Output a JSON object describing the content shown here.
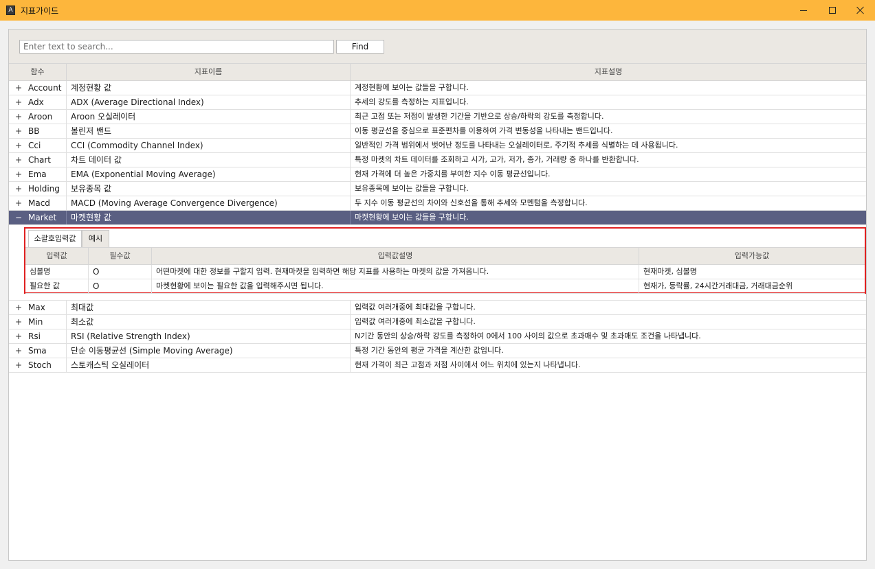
{
  "window": {
    "title": "지표가이드",
    "icon_letter": "A",
    "accent_color": "#fdb63c",
    "controls": [
      "minimize",
      "maximize",
      "close"
    ]
  },
  "search": {
    "placeholder": "Enter text to search...",
    "value": "",
    "find_label": "Find"
  },
  "grid": {
    "columns": [
      "함수",
      "지표이름",
      "지표설명"
    ],
    "selected_color": "#5a5f82",
    "rows_before": [
      {
        "expand": "+",
        "name": "Account",
        "display": "계정현황 값",
        "desc": "계정현황에 보이는 값들을 구합니다."
      },
      {
        "expand": "+",
        "name": "Adx",
        "display": "ADX (Average Directional Index)",
        "desc": "추세의 강도를 측정하는 지표입니다."
      },
      {
        "expand": "+",
        "name": "Aroon",
        "display": "Aroon 오실레이터",
        "desc": "최근 고점 또는 저점이 발생한 기간을 기반으로 상승/하락의 강도를 측정합니다."
      },
      {
        "expand": "+",
        "name": "BB",
        "display": "볼린저 밴드",
        "desc": "이동 평균선을 중심으로 표준편차를 이용하여 가격 변동성을 나타내는 밴드입니다."
      },
      {
        "expand": "+",
        "name": "Cci",
        "display": "CCI (Commodity Channel Index)",
        "desc": "일반적인 가격 범위에서 벗어난 정도를 나타내는 오실레이터로, 주기적 추세를 식별하는 데 사용됩니다."
      },
      {
        "expand": "+",
        "name": "Chart",
        "display": "차트 데이터 값",
        "desc": "특정 마켓의 차트 데이터를 조회하고 시가, 고가, 저가, 종가, 거래량 중 하나를 반환합니다."
      },
      {
        "expand": "+",
        "name": "Ema",
        "display": "EMA (Exponential Moving Average)",
        "desc": "현재 가격에 더 높은 가중치를 부여한 지수 이동 평균선입니다."
      },
      {
        "expand": "+",
        "name": "Holding",
        "display": "보유종목 값",
        "desc": "보유종목에 보이는 값들을 구합니다."
      },
      {
        "expand": "+",
        "name": "Macd",
        "display": "MACD (Moving Average Convergence Divergence)",
        "desc": "두 지수 이동 평균선의 차이와 신호선을 통해 추세와 모멘텀을 측정합니다."
      }
    ],
    "selected_row": {
      "expand": "−",
      "name": "Market",
      "display": "마켓현황 값",
      "desc": "마켓현황에 보이는 값들을 구합니다."
    },
    "detail": {
      "tabs": [
        "소괄호입력값",
        "예시"
      ],
      "columns": [
        "입력값",
        "필수값",
        "입력값설명",
        "입력가능값"
      ],
      "rows": [
        {
          "input": "심볼명",
          "required": "O",
          "desc": "어떤마켓에 대한 정보를 구할지 입력. 현재마켓을 입력하면 해당 지표를 사용하는 마켓의 값을 가져옵니다.",
          "allowed": "현재마켓, 심볼명"
        },
        {
          "input": "필요한 값",
          "required": "O",
          "desc": "마켓현황에 보이는 필요한 값을 입력해주시면 됩니다.",
          "allowed": "현재가, 등락률, 24시간거래대금, 거래대금순위"
        }
      ]
    },
    "rows_after": [
      {
        "expand": "+",
        "name": "Max",
        "display": "최대값",
        "desc": "입력값 여러개중에 최대값을 구합니다."
      },
      {
        "expand": "+",
        "name": "Min",
        "display": "최소값",
        "desc": "입력값 여러개중에 최소값을 구합니다."
      },
      {
        "expand": "+",
        "name": "Rsi",
        "display": "RSI (Relative Strength Index)",
        "desc": "N기간 동안의 상승/하락 강도를 측정하여 0에서 100 사이의 값으로 초과매수 및 초과매도 조건을 나타냅니다."
      },
      {
        "expand": "+",
        "name": "Sma",
        "display": "단순 이동평균선 (Simple Moving Average)",
        "desc": "특정 기간 동안의 평균 가격을 계산한 값입니다."
      },
      {
        "expand": "+",
        "name": "Stoch",
        "display": "스토캐스틱 오실레이터",
        "desc": "현재 가격이 최근 고점과 저점 사이에서 어느 위치에 있는지 나타냅니다."
      }
    ]
  }
}
